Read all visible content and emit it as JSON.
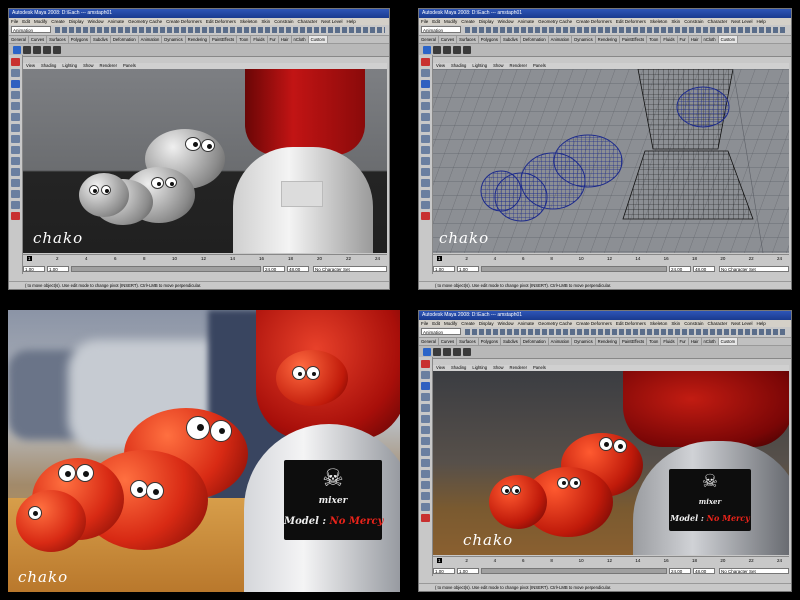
{
  "window": {
    "title": "Autodesk Maya 2008: D:\\Each  ---  amstaph01",
    "menus": [
      "File",
      "Edit",
      "Modify",
      "Create",
      "Display",
      "Window",
      "Animate",
      "Geometry Cache",
      "Create Deformers",
      "Edit Deformers",
      "Skeleton",
      "Skin",
      "Constrain",
      "Character",
      "Next Level",
      "Help"
    ],
    "mode": "Animation",
    "shelf_tabs": [
      "General",
      "Curves",
      "Surfaces",
      "Polygons",
      "Subdivs",
      "Deformation",
      "Animation",
      "Dynamics",
      "Rendering",
      "PaintEffects",
      "Toon",
      "Fluids",
      "Fur",
      "Hair",
      "nCloth",
      "Custom"
    ],
    "active_shelf_tab": "Custom",
    "panel_menus": [
      "View",
      "Shading",
      "Lighting",
      "Show",
      "Renderer",
      "Panels"
    ],
    "time_ticks": [
      "1",
      "2",
      "4",
      "6",
      "8",
      "10",
      "12",
      "14",
      "16",
      "18",
      "20",
      "22",
      "24"
    ],
    "current_frame": "1",
    "range_start": "1.00",
    "range_start_inner": "1.00",
    "range_end_inner": "24.00",
    "range_end": "48.00",
    "character_set": "No Character Set",
    "help_text": "( to move object(s). Use edit mode to change pivot (INSERT). Ctrl+LMB to move perpendicular."
  },
  "watermark": "chako",
  "label": {
    "brand": "mixer",
    "motto_prefix": "Model : ",
    "motto_highlight": "No Mercy"
  },
  "colors": {
    "tomato_red": "#d82a14",
    "blender_red": "#b01010",
    "wire_blue": "#1c2a8c",
    "viewport_grey": "#8c8f94"
  }
}
